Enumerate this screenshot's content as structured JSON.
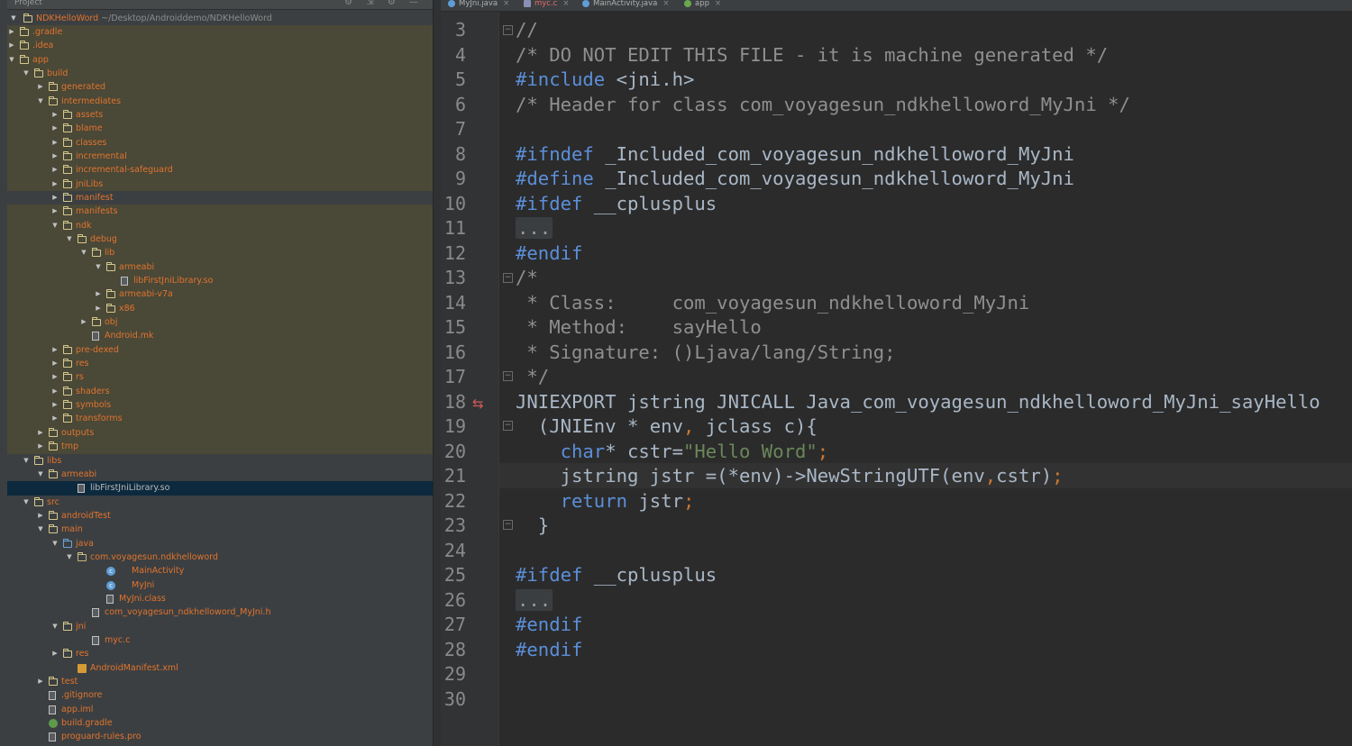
{
  "project_panel": {
    "title": "Project",
    "root_name": "NDKHelloWord",
    "root_path": "~/Desktop/Androiddemo/NDKHelloWord",
    "items": [
      {
        "label": ".gradle"
      },
      {
        "label": ".idea"
      },
      {
        "label": "app"
      },
      {
        "label": "build"
      },
      {
        "label": "generated"
      },
      {
        "label": "intermediates"
      },
      {
        "label": "assets"
      },
      {
        "label": "blame"
      },
      {
        "label": "classes"
      },
      {
        "label": "incremental"
      },
      {
        "label": "incremental-safeguard"
      },
      {
        "label": "jniLibs"
      },
      {
        "label": "manifest"
      },
      {
        "label": "manifests"
      },
      {
        "label": "ndk"
      },
      {
        "label": "debug"
      },
      {
        "label": "lib"
      },
      {
        "label": "armeabi"
      },
      {
        "label": "libFirstJniLibrary.so"
      },
      {
        "label": "armeabi-v7a"
      },
      {
        "label": "x86"
      },
      {
        "label": "obj"
      },
      {
        "label": "Android.mk"
      },
      {
        "label": "pre-dexed"
      },
      {
        "label": "res"
      },
      {
        "label": "rs"
      },
      {
        "label": "shaders"
      },
      {
        "label": "symbols"
      },
      {
        "label": "transforms"
      },
      {
        "label": "outputs"
      },
      {
        "label": "tmp"
      },
      {
        "label": "libs"
      },
      {
        "label": "armeabi"
      },
      {
        "label": "libFirstJniLibrary.so"
      },
      {
        "label": "src"
      },
      {
        "label": "androidTest"
      },
      {
        "label": "main"
      },
      {
        "label": "java"
      },
      {
        "label": "com.voyagesun.ndkhelloword"
      },
      {
        "label": "MainActivity"
      },
      {
        "label": "MyJni"
      },
      {
        "label": "MyJni.class"
      },
      {
        "label": "com_voyagesun_ndkhelloword_MyJni.h"
      },
      {
        "label": "jni"
      },
      {
        "label": "myc.c"
      },
      {
        "label": "res"
      },
      {
        "label": "AndroidManifest.xml"
      },
      {
        "label": "test"
      },
      {
        "label": ".gitignore"
      },
      {
        "label": "app.iml"
      },
      {
        "label": "build.gradle"
      },
      {
        "label": "proguard-rules.pro"
      }
    ]
  },
  "tabs": [
    {
      "label": "MyJni.java",
      "icon": "class-icon"
    },
    {
      "label": "myc.c",
      "icon": "c-file-icon",
      "active": true
    },
    {
      "label": "MainActivity.java",
      "icon": "class-icon"
    },
    {
      "label": "app",
      "icon": "gradle-icon"
    }
  ],
  "editor": {
    "file": "com_voyagesun_ndkhelloword_MyJni.h",
    "line_numbers": [
      "3",
      "4",
      "5",
      "6",
      "7",
      "8",
      "9",
      "10",
      "11",
      "12",
      "13",
      "14",
      "15",
      "16",
      "17",
      "18",
      "19",
      "20",
      "21",
      "22",
      "23",
      "24",
      "25",
      "26",
      "27",
      "28",
      "29",
      "30"
    ],
    "lines": {
      "l3": "//",
      "l4": "/* DO NOT EDIT THIS FILE - it is machine generated */",
      "l5_kw": "#include",
      "l5_rest": " <jni.h>",
      "l6": "/* Header for class com_voyagesun_ndkhelloword_MyJni */",
      "l8_kw": "#ifndef",
      "l8_rest": " _Included_com_voyagesun_ndkhelloword_MyJni",
      "l9_kw": "#define",
      "l9_rest": " _Included_com_voyagesun_ndkhelloword_MyJni",
      "l10_kw": "#ifdef",
      "l10_rest": " __cplusplus",
      "l11": "...",
      "l12_kw": "#endif",
      "l13": "/*",
      "l14": " * Class:     com_voyagesun_ndkhelloword_MyJni",
      "l15": " * Method:    sayHello",
      "l16": " * Signature: ()Ljava/lang/String;",
      "l17": " */",
      "l18": "JNIEXPORT jstring JNICALL Java_com_voyagesun_ndkhelloword_MyJni_sayHello",
      "l19_a": "  (JNIEnv * env",
      "l19_b": ",",
      "l19_c": " jclass c){",
      "l20_kw": "    char",
      "l20_a": "* cstr=",
      "l20_str": "\"Hello Word\"",
      "l20_b": ";",
      "l21_a": "    jstring jstr =(*env)->NewStringUTF(env",
      "l21_b": ",",
      "l21_c": "cstr)",
      "l21_d": ";",
      "l22_kw": "    return",
      "l22_a": " jstr",
      "l22_b": ";",
      "l23": "  }",
      "l25_kw": "#ifdef",
      "l25_rest": " __cplusplus",
      "l26": "...",
      "l27_kw": "#endif",
      "l28_kw": "#endif"
    }
  },
  "colors": {
    "editor_bg": "#2b2b2b",
    "keyword": "#cc7832",
    "preprocessor": "#5b8fd9",
    "string": "#6a8759",
    "comment": "#8f8f8f",
    "tree_label": "#e0742e",
    "selection": "#0d293e"
  }
}
